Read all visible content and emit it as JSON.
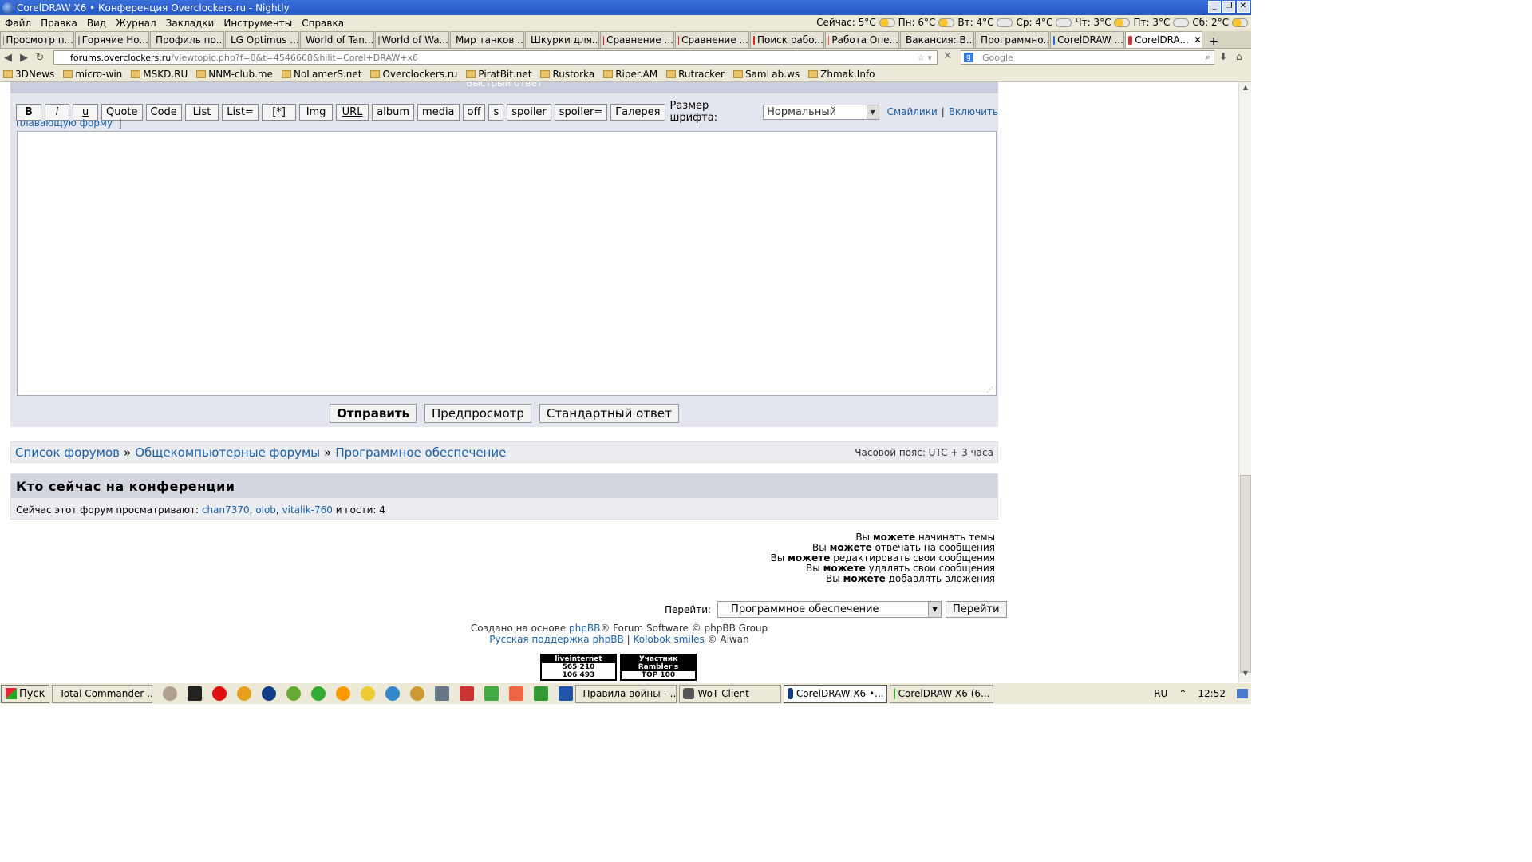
{
  "window": {
    "title": "CorelDRAW X6 • Конференция Overclockers.ru - Nightly"
  },
  "menu": {
    "items": [
      "Файл",
      "Правка",
      "Вид",
      "Журнал",
      "Закладки",
      "Инструменты",
      "Справка"
    ]
  },
  "weather": [
    "Сейчас: 5°C",
    "Пн: 6°C",
    "Вт: 4°C",
    "Ср: 4°C",
    "Чт: 3°C",
    "Пт: 3°C",
    "Сб: 2°C"
  ],
  "tabs": [
    "Просмотр п...",
    "Горячие Но...",
    "Профиль по...",
    "LG Optimus ...",
    "World of Tan...",
    "World of Wa...",
    "Мир танков ...",
    "Шкурки для...",
    "Сравнение ...",
    "Сравнение ...",
    "Поиск рабо...",
    "Работа Опе...",
    "Вакансия: В...",
    "Программно...",
    "CorelDRAW ...",
    "CorelDRA..."
  ],
  "url": {
    "domain": "forums.overclockers.ru",
    "path": "/viewtopic.php?f=8&t=4546668&hilit=Corel+DRAW+x6"
  },
  "search": {
    "placeholder": "Google"
  },
  "bookmarks": [
    "3DNews",
    "micro-win",
    "MSKD.RU",
    "NNM-club.me",
    "NoLamerS.net",
    "Overclockers.ru",
    "PiratBit.net",
    "Rustorka",
    "Riper.AM",
    "Rutracker",
    "SamLab.ws",
    "Zhmak.Info"
  ],
  "reply": {
    "header": "Быстрый ответ",
    "buttons": [
      "B",
      "i",
      "u",
      "Quote",
      "Code",
      "List",
      "List=",
      "[*]",
      "Img",
      "URL",
      "album",
      "media",
      "off",
      "s",
      "spoiler",
      "spoiler=",
      "Галерея"
    ],
    "font_label": "Размер шрифта:",
    "font_value": "Нормальный",
    "smileys": "Смайлики",
    "enable": "Включить",
    "floating": "плавающую форму",
    "pipe": "|",
    "submit": "Отправить",
    "preview": "Предпросмотр",
    "standard": "Стандартный ответ"
  },
  "breadcrumb": {
    "items": [
      "Список форумов",
      "Общекомпьютерные форумы",
      "Программное обеспечение"
    ],
    "sep": "»",
    "timezone": "Часовой пояс: UTC + 3 часа"
  },
  "online": {
    "title": "Кто сейчас на конференции",
    "prefix": "Сейчас этот форум просматривают:",
    "users": [
      "chan7370",
      "olob",
      "vitalik-760"
    ],
    "suffix": "и гости: 4"
  },
  "permissions": [
    [
      "Вы",
      "можете",
      "начинать темы"
    ],
    [
      "Вы",
      "можете",
      "отвечать на сообщения"
    ],
    [
      "Вы",
      "можете",
      "редактировать свои сообщения"
    ],
    [
      "Вы",
      "можете",
      "удалять свои сообщения"
    ],
    [
      "Вы",
      "можете",
      "добавлять вложения"
    ]
  ],
  "jump": {
    "label": "Перейти:",
    "value": "Программное обеспечение",
    "button": "Перейти"
  },
  "footer": {
    "line1_pre": "Создано на основе",
    "phpbb": "phpBB",
    "line1_post": "® Forum Software © phpBB Group",
    "support": "Русская поддержка phpBB",
    "sep": "|",
    "kolobok": "Kolobok smiles",
    "aiwan": "© Aiwan"
  },
  "counters": {
    "li_title": "liveinternet",
    "li_v1": "565 210",
    "li_v2": "106 493",
    "rb1": "Участник",
    "rb2": "Rambler's",
    "rb3": "TOP 100"
  },
  "taskbar": {
    "start": "Пуск",
    "items": [
      "Total Commander ...",
      "Правила войны - ...",
      "WoT Client",
      "CorelDRAW X6 •...",
      "CorelDRAW X6 (6..."
    ],
    "lang": "RU",
    "time": "12:52"
  }
}
